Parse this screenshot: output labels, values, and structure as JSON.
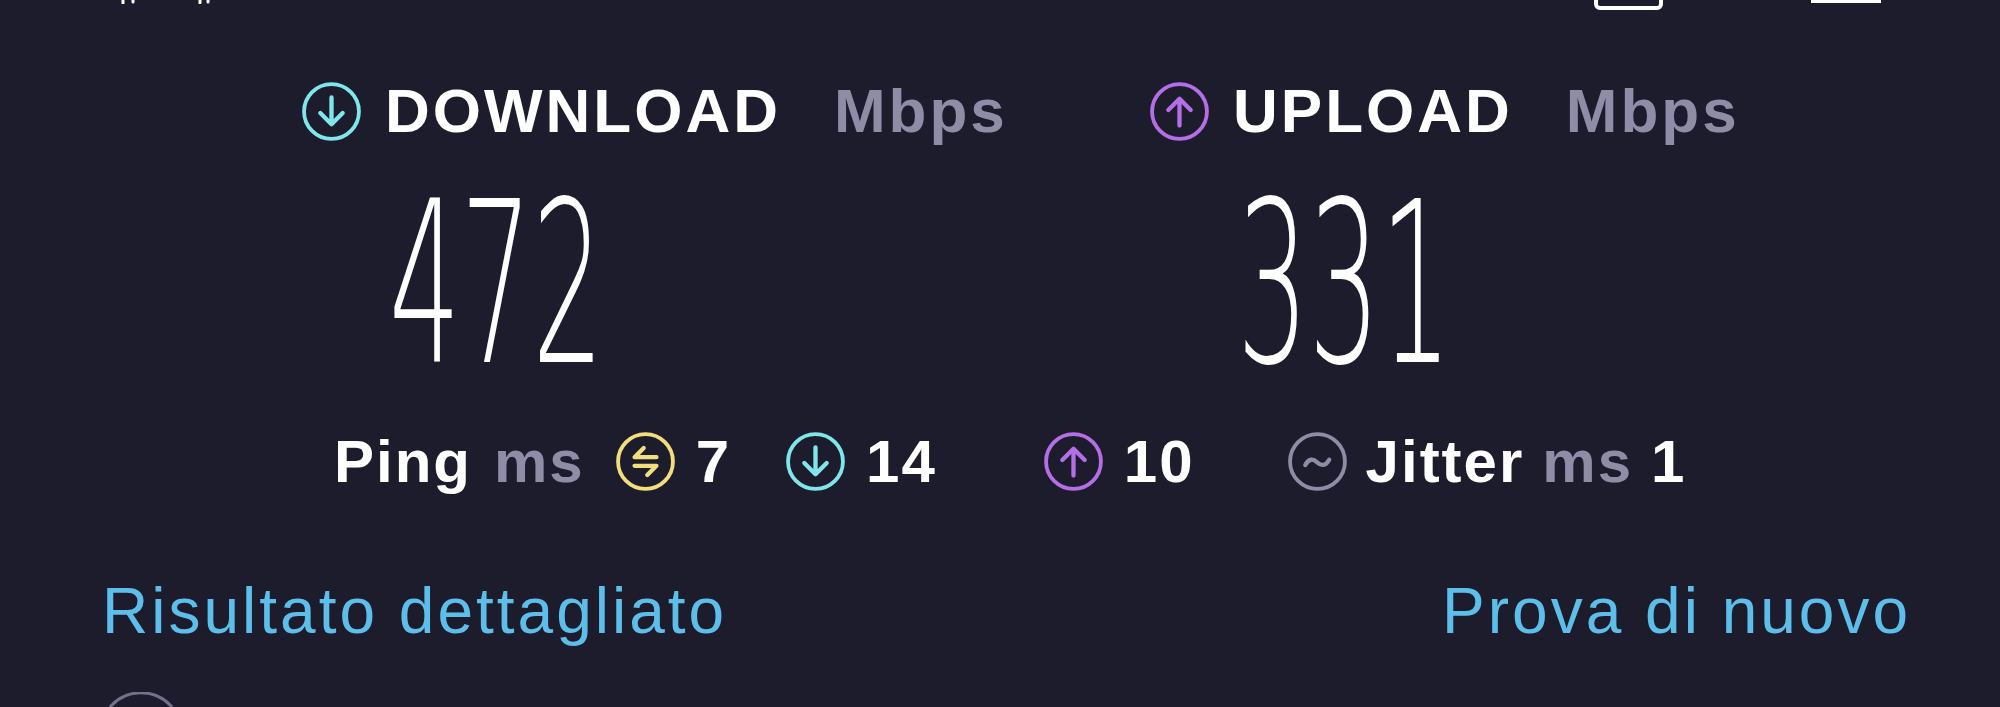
{
  "speeds": [
    {
      "kind": "download",
      "label": "DOWNLOAD",
      "unit": "Mbps",
      "value": "472",
      "color": "#80e6ea"
    },
    {
      "kind": "upload",
      "label": "UPLOAD",
      "unit": "Mbps",
      "value": "331",
      "color": "#b46ee6"
    }
  ],
  "ping": {
    "label": "Ping",
    "unit": "ms",
    "readings": [
      {
        "kind": "idle",
        "value": "7",
        "color": "#f2de7c"
      },
      {
        "kind": "download",
        "value": "14",
        "color": "#80e6ea"
      },
      {
        "kind": "upload",
        "value": "10",
        "color": "#b46ee6"
      }
    ]
  },
  "jitter": {
    "label": "Jitter",
    "unit": "ms",
    "value": "1"
  },
  "links": [
    {
      "label": "Risultato dettagliato"
    },
    {
      "label": "Prova di nuovo"
    }
  ]
}
